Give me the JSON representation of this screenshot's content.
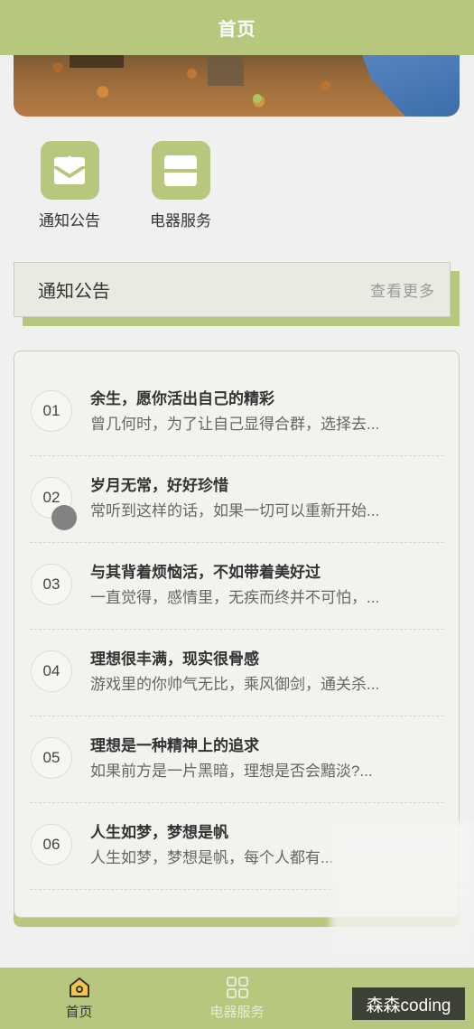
{
  "header": {
    "title": "首页"
  },
  "quick_links": [
    {
      "label": "通知公告",
      "icon": "envelope-icon"
    },
    {
      "label": "电器服务",
      "icon": "panel-icon"
    }
  ],
  "notices": {
    "title": "通知公告",
    "more": "查看更多",
    "items": [
      {
        "num": "01",
        "title": "余生，愿你活出自己的精彩",
        "desc": "曾几何时，为了让自己显得合群，选择去..."
      },
      {
        "num": "02",
        "title": "岁月无常，好好珍惜",
        "desc": "常听到这样的话，如果一切可以重新开始..."
      },
      {
        "num": "03",
        "title": "与其背着烦恼活，不如带着美好过",
        "desc": "一直觉得，感情里，无疾而终并不可怕，..."
      },
      {
        "num": "04",
        "title": "理想很丰满，现实很骨感",
        "desc": "游戏里的你帅气无比，乘风御剑，通关杀..."
      },
      {
        "num": "05",
        "title": "理想是一种精神上的追求",
        "desc": "如果前方是一片黑暗，理想是否会黯淡?..."
      },
      {
        "num": "06",
        "title": "人生如梦，梦想是帆",
        "desc": "人生如梦，梦想是帆，每个人都有..."
      }
    ]
  },
  "tabbar": {
    "items": [
      {
        "label": "首页",
        "icon": "home-icon",
        "active": true
      },
      {
        "label": "电器服务",
        "icon": "grid-icon",
        "active": false
      }
    ]
  },
  "watermark": "森森coding",
  "colors": {
    "accent": "#b7c77d",
    "background": "#f0f0f0"
  }
}
